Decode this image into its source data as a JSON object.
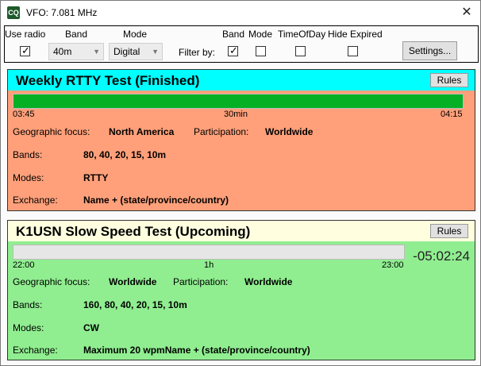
{
  "window": {
    "icon_text": "CQ",
    "title": "VFO: 7.081 MHz",
    "close_glyph": "✕"
  },
  "toolbar": {
    "use_radio_label": "Use radio",
    "use_radio_checked": true,
    "band_label": "Band",
    "band_value": "40m",
    "mode_label": "Mode",
    "mode_value": "Digital",
    "filter_by_label": "Filter by:",
    "filter_band_label": "Band",
    "filter_band_checked": true,
    "filter_mode_label": "Mode",
    "filter_mode_checked": false,
    "filter_timeofday_label": "TimeOfDay",
    "filter_timeofday_checked": false,
    "filter_hide_expired_label": "Hide Expired",
    "filter_hide_expired_checked": false,
    "settings_label": "Settings..."
  },
  "contests": [
    {
      "title": "Weekly RTTY Test (Finished)",
      "header_color": "#00ffff",
      "body_color": "#ffa07a",
      "rules_label": "Rules",
      "start_time": "03:45",
      "duration": "30min",
      "end_time": "04:15",
      "progress": 1.0,
      "countdown": "",
      "geo_label": "Geographic focus:",
      "geo_value": "North America",
      "participation_label": "Participation:",
      "participation_value": "Worldwide",
      "bands_label": "Bands:",
      "bands_value": "80, 40, 20, 15, 10m",
      "modes_label": "Modes:",
      "modes_value": "RTTY",
      "exchange_label": "Exchange:",
      "exchange_value": "Name + (state/province/country)"
    },
    {
      "title": "K1USN Slow Speed Test (Upcoming)",
      "header_color": "#ffffe0",
      "body_color": "#90ee90",
      "rules_label": "Rules",
      "start_time": "22:00",
      "duration": "1h",
      "end_time": "23:00",
      "progress": 0.0,
      "countdown": "-05:02:24",
      "geo_label": "Geographic focus:",
      "geo_value": "Worldwide",
      "participation_label": "Participation:",
      "participation_value": "Worldwide",
      "bands_label": "Bands:",
      "bands_value": "160, 80, 40, 20, 15, 10m",
      "modes_label": "Modes:",
      "modes_value": "CW",
      "exchange_label": "Exchange:",
      "exchange_value": "Maximum 20 wpmName + (state/province/country)"
    }
  ]
}
